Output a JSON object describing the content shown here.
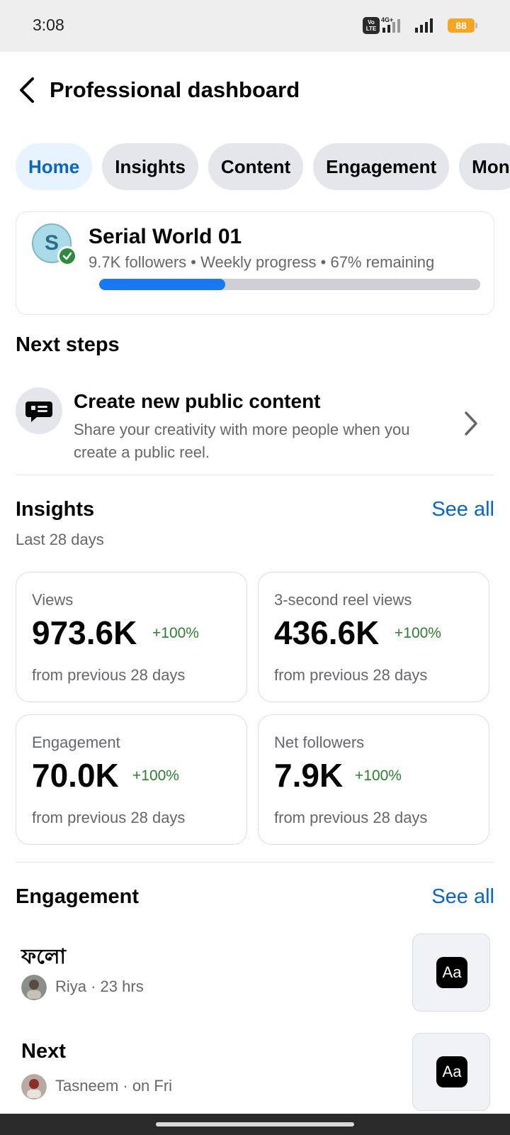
{
  "status_bar": {
    "time": "3:08",
    "network_badge": "Vo LTE",
    "network_type": "4G+",
    "battery": "88",
    "battery_color": "#f5a623"
  },
  "header": {
    "title": "Professional dashboard",
    "back_icon": "chevron-left-icon"
  },
  "tabs": [
    {
      "label": "Home",
      "active": true
    },
    {
      "label": "Insights",
      "active": false
    },
    {
      "label": "Content",
      "active": false
    },
    {
      "label": "Engagement",
      "active": false
    },
    {
      "label": "Mon",
      "active": false
    }
  ],
  "profile": {
    "avatar_letter": "S",
    "name": "Serial World 01",
    "meta": "9.7K followers • Weekly progress • 67% remaining",
    "weekly_progress_fraction": 0.33,
    "accent_color": "#1877f2"
  },
  "next_steps": {
    "title": "Next steps",
    "item": {
      "icon": "chat-bubble-icon",
      "title": "Create new public content",
      "description": "Share your creativity with more people when you create a public reel."
    }
  },
  "insights": {
    "title": "Insights",
    "see_all": "See all",
    "period": "Last 28 days",
    "cards": [
      {
        "label": "Views",
        "value": "973.6K",
        "change": "+100%",
        "foot": "from previous 28 days"
      },
      {
        "label": "3-second reel views",
        "value": "436.6K",
        "change": "+100%",
        "foot": "from previous 28 days"
      },
      {
        "label": "Engagement",
        "value": "70.0K",
        "change": "+100%",
        "foot": "from previous 28 days"
      },
      {
        "label": "Net followers",
        "value": "7.9K",
        "change": "+100%",
        "foot": "from previous 28 days"
      }
    ],
    "positive_color": "#2e7d32"
  },
  "engagement": {
    "title": "Engagement",
    "see_all": "See all",
    "items": [
      {
        "title": "ফলো",
        "meta": "Riya · 23 hrs",
        "thumb_text": "Aa"
      },
      {
        "title": "Next",
        "meta": "Tasneem · on Fri",
        "thumb_text": "Aa"
      }
    ]
  }
}
